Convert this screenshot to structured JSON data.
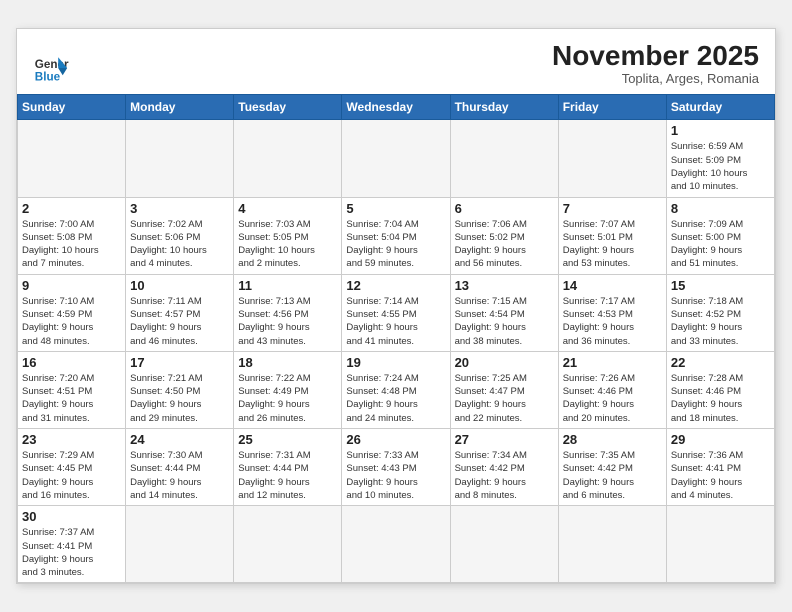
{
  "header": {
    "logo_general": "General",
    "logo_blue": "Blue",
    "month_title": "November 2025",
    "subtitle": "Toplita, Arges, Romania"
  },
  "weekdays": [
    "Sunday",
    "Monday",
    "Tuesday",
    "Wednesday",
    "Thursday",
    "Friday",
    "Saturday"
  ],
  "days": [
    {
      "date": "",
      "info": ""
    },
    {
      "date": "",
      "info": ""
    },
    {
      "date": "",
      "info": ""
    },
    {
      "date": "",
      "info": ""
    },
    {
      "date": "",
      "info": ""
    },
    {
      "date": "",
      "info": ""
    },
    {
      "date": "1",
      "info": "Sunrise: 6:59 AM\nSunset: 5:09 PM\nDaylight: 10 hours\nand 10 minutes."
    },
    {
      "date": "2",
      "info": "Sunrise: 7:00 AM\nSunset: 5:08 PM\nDaylight: 10 hours\nand 7 minutes."
    },
    {
      "date": "3",
      "info": "Sunrise: 7:02 AM\nSunset: 5:06 PM\nDaylight: 10 hours\nand 4 minutes."
    },
    {
      "date": "4",
      "info": "Sunrise: 7:03 AM\nSunset: 5:05 PM\nDaylight: 10 hours\nand 2 minutes."
    },
    {
      "date": "5",
      "info": "Sunrise: 7:04 AM\nSunset: 5:04 PM\nDaylight: 9 hours\nand 59 minutes."
    },
    {
      "date": "6",
      "info": "Sunrise: 7:06 AM\nSunset: 5:02 PM\nDaylight: 9 hours\nand 56 minutes."
    },
    {
      "date": "7",
      "info": "Sunrise: 7:07 AM\nSunset: 5:01 PM\nDaylight: 9 hours\nand 53 minutes."
    },
    {
      "date": "8",
      "info": "Sunrise: 7:09 AM\nSunset: 5:00 PM\nDaylight: 9 hours\nand 51 minutes."
    },
    {
      "date": "9",
      "info": "Sunrise: 7:10 AM\nSunset: 4:59 PM\nDaylight: 9 hours\nand 48 minutes."
    },
    {
      "date": "10",
      "info": "Sunrise: 7:11 AM\nSunset: 4:57 PM\nDaylight: 9 hours\nand 46 minutes."
    },
    {
      "date": "11",
      "info": "Sunrise: 7:13 AM\nSunset: 4:56 PM\nDaylight: 9 hours\nand 43 minutes."
    },
    {
      "date": "12",
      "info": "Sunrise: 7:14 AM\nSunset: 4:55 PM\nDaylight: 9 hours\nand 41 minutes."
    },
    {
      "date": "13",
      "info": "Sunrise: 7:15 AM\nSunset: 4:54 PM\nDaylight: 9 hours\nand 38 minutes."
    },
    {
      "date": "14",
      "info": "Sunrise: 7:17 AM\nSunset: 4:53 PM\nDaylight: 9 hours\nand 36 minutes."
    },
    {
      "date": "15",
      "info": "Sunrise: 7:18 AM\nSunset: 4:52 PM\nDaylight: 9 hours\nand 33 minutes."
    },
    {
      "date": "16",
      "info": "Sunrise: 7:20 AM\nSunset: 4:51 PM\nDaylight: 9 hours\nand 31 minutes."
    },
    {
      "date": "17",
      "info": "Sunrise: 7:21 AM\nSunset: 4:50 PM\nDaylight: 9 hours\nand 29 minutes."
    },
    {
      "date": "18",
      "info": "Sunrise: 7:22 AM\nSunset: 4:49 PM\nDaylight: 9 hours\nand 26 minutes."
    },
    {
      "date": "19",
      "info": "Sunrise: 7:24 AM\nSunset: 4:48 PM\nDaylight: 9 hours\nand 24 minutes."
    },
    {
      "date": "20",
      "info": "Sunrise: 7:25 AM\nSunset: 4:47 PM\nDaylight: 9 hours\nand 22 minutes."
    },
    {
      "date": "21",
      "info": "Sunrise: 7:26 AM\nSunset: 4:46 PM\nDaylight: 9 hours\nand 20 minutes."
    },
    {
      "date": "22",
      "info": "Sunrise: 7:28 AM\nSunset: 4:46 PM\nDaylight: 9 hours\nand 18 minutes."
    },
    {
      "date": "23",
      "info": "Sunrise: 7:29 AM\nSunset: 4:45 PM\nDaylight: 9 hours\nand 16 minutes."
    },
    {
      "date": "24",
      "info": "Sunrise: 7:30 AM\nSunset: 4:44 PM\nDaylight: 9 hours\nand 14 minutes."
    },
    {
      "date": "25",
      "info": "Sunrise: 7:31 AM\nSunset: 4:44 PM\nDaylight: 9 hours\nand 12 minutes."
    },
    {
      "date": "26",
      "info": "Sunrise: 7:33 AM\nSunset: 4:43 PM\nDaylight: 9 hours\nand 10 minutes."
    },
    {
      "date": "27",
      "info": "Sunrise: 7:34 AM\nSunset: 4:42 PM\nDaylight: 9 hours\nand 8 minutes."
    },
    {
      "date": "28",
      "info": "Sunrise: 7:35 AM\nSunset: 4:42 PM\nDaylight: 9 hours\nand 6 minutes."
    },
    {
      "date": "29",
      "info": "Sunrise: 7:36 AM\nSunset: 4:41 PM\nDaylight: 9 hours\nand 4 minutes."
    },
    {
      "date": "30",
      "info": "Sunrise: 7:37 AM\nSunset: 4:41 PM\nDaylight: 9 hours\nand 3 minutes."
    },
    {
      "date": "",
      "info": ""
    },
    {
      "date": "",
      "info": ""
    },
    {
      "date": "",
      "info": ""
    },
    {
      "date": "",
      "info": ""
    },
    {
      "date": "",
      "info": ""
    },
    {
      "date": "",
      "info": ""
    }
  ]
}
